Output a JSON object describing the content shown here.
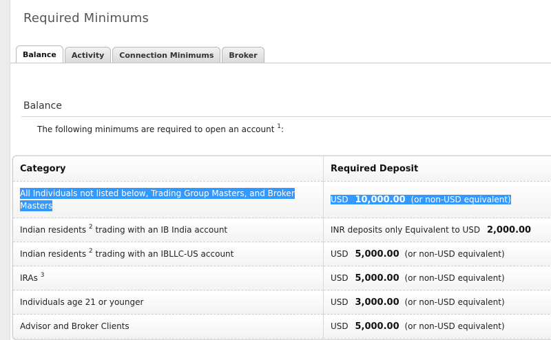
{
  "page": {
    "title": "Required Minimums"
  },
  "tabs": [
    {
      "label": "Balance",
      "active": true
    },
    {
      "label": "Activity",
      "active": false
    },
    {
      "label": "Connection Minimums",
      "active": false
    },
    {
      "label": "Broker",
      "active": false
    }
  ],
  "section": {
    "title": "Balance",
    "intro": "The following minimums are required to open an account",
    "intro_footnote": "1",
    "intro_suffix": ":"
  },
  "table": {
    "headers": [
      "Category",
      "Required Deposit"
    ],
    "rows": [
      {
        "category": "All Individuals not listed below, Trading Group Masters, and Broker Masters",
        "footnote": "",
        "category_suffix": "",
        "currency": "USD",
        "amount": "10,000.00",
        "note": "(or non-USD equivalent)",
        "selected": true
      },
      {
        "category": "Indian residents",
        "footnote": "2",
        "category_suffix": " trading with an IB India account",
        "prefix": "INR deposits only Equivalent to USD",
        "amount": "2,000.00",
        "note": ""
      },
      {
        "category": "Indian residents",
        "footnote": "2",
        "category_suffix": " trading with an IBLLC-US account",
        "currency": "USD",
        "amount": "5,000.00",
        "note": "(or non-USD equivalent)"
      },
      {
        "category": "IRAs",
        "footnote": "3",
        "category_suffix": "",
        "currency": "USD",
        "amount": "5,000.00",
        "note": "(or non-USD equivalent)"
      },
      {
        "category": "Individuals age 21 or younger",
        "footnote": "",
        "category_suffix": "",
        "currency": "USD",
        "amount": "3,000.00",
        "note": "(or non-USD equivalent)"
      },
      {
        "category": "Advisor and Broker Clients",
        "footnote": "",
        "category_suffix": "",
        "currency": "USD",
        "amount": "5,000.00",
        "note": "(or non-USD equivalent)"
      }
    ]
  },
  "colors": {
    "selection": "#3399ff",
    "background": "#f0f0f0"
  }
}
